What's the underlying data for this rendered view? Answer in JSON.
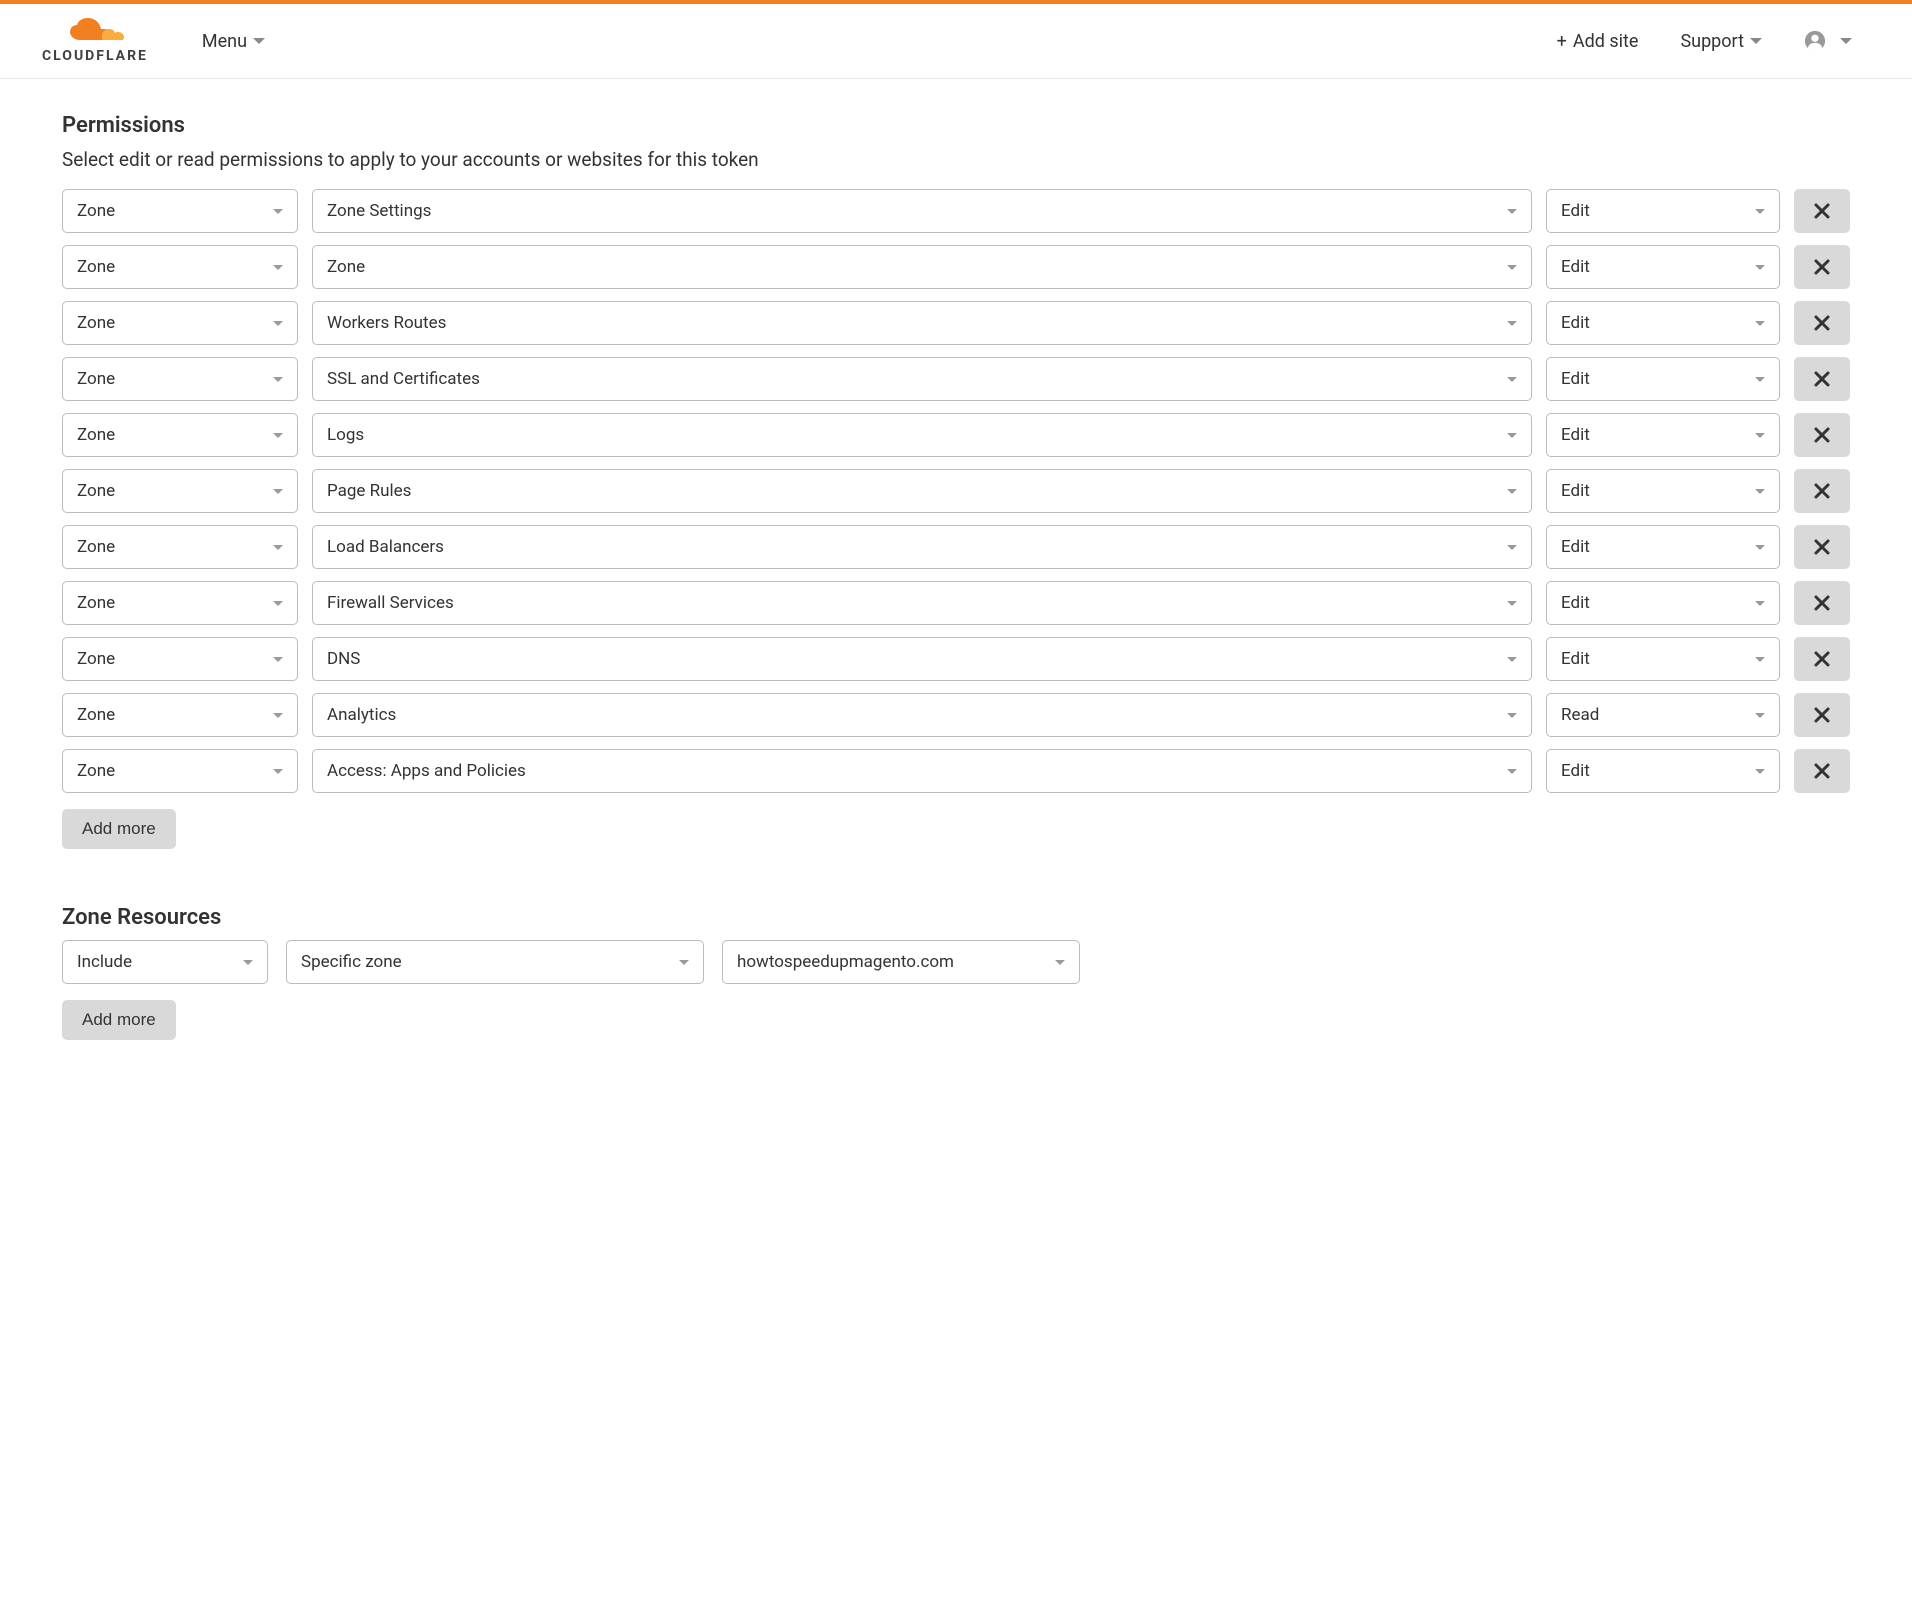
{
  "header": {
    "logo_text": "CLOUDFLARE",
    "menu": "Menu",
    "add_site": "Add site",
    "support": "Support"
  },
  "permissions": {
    "title": "Permissions",
    "description": "Select edit or read permissions to apply to your accounts or websites for this token",
    "rows": [
      {
        "scope": "Zone",
        "permission": "Zone Settings",
        "access": "Edit"
      },
      {
        "scope": "Zone",
        "permission": "Zone",
        "access": "Edit"
      },
      {
        "scope": "Zone",
        "permission": "Workers Routes",
        "access": "Edit"
      },
      {
        "scope": "Zone",
        "permission": "SSL and Certificates",
        "access": "Edit"
      },
      {
        "scope": "Zone",
        "permission": "Logs",
        "access": "Edit"
      },
      {
        "scope": "Zone",
        "permission": "Page Rules",
        "access": "Edit"
      },
      {
        "scope": "Zone",
        "permission": "Load Balancers",
        "access": "Edit"
      },
      {
        "scope": "Zone",
        "permission": "Firewall Services",
        "access": "Edit"
      },
      {
        "scope": "Zone",
        "permission": "DNS",
        "access": "Edit"
      },
      {
        "scope": "Zone",
        "permission": "Analytics",
        "access": "Read"
      },
      {
        "scope": "Zone",
        "permission": "Access: Apps and Policies",
        "access": "Edit"
      }
    ],
    "add_more": "Add more"
  },
  "zone_resources": {
    "title": "Zone Resources",
    "include": "Include",
    "zone_type": "Specific zone",
    "zone": "howtospeedupmagento.com",
    "add_more": "Add more"
  }
}
